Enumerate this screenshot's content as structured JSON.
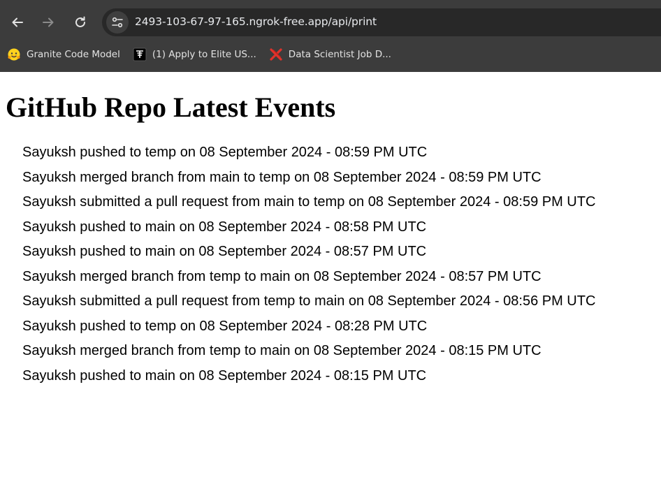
{
  "browser": {
    "url": "2493-103-67-97-165.ngrok-free.app/api/print",
    "bookmarks": [
      {
        "label": "Granite Code Model",
        "icon": "hugging-face-icon"
      },
      {
        "label": "(1) Apply to Elite US...",
        "icon": "job-board-icon"
      },
      {
        "label": "Data Scientist Job D...",
        "icon": "x-logo-icon"
      }
    ]
  },
  "page": {
    "title": "GitHub Repo Latest Events",
    "events": [
      "Sayuksh pushed to temp on 08 September 2024 - 08:59 PM UTC",
      "Sayuksh merged branch from main to temp on 08 September 2024 - 08:59 PM UTC",
      "Sayuksh submitted a pull request from main to temp on 08 September 2024 - 08:59 PM UTC",
      "Sayuksh pushed to main on 08 September 2024 - 08:58 PM UTC",
      "Sayuksh pushed to main on 08 September 2024 - 08:57 PM UTC",
      "Sayuksh merged branch from temp to main on 08 September 2024 - 08:57 PM UTC",
      "Sayuksh submitted a pull request from temp to main on 08 September 2024 - 08:56 PM UTC",
      "Sayuksh pushed to temp on 08 September 2024 - 08:28 PM UTC",
      "Sayuksh merged branch from temp to main on 08 September 2024 - 08:15 PM UTC",
      "Sayuksh pushed to main on 08 September 2024 - 08:15 PM UTC"
    ]
  }
}
